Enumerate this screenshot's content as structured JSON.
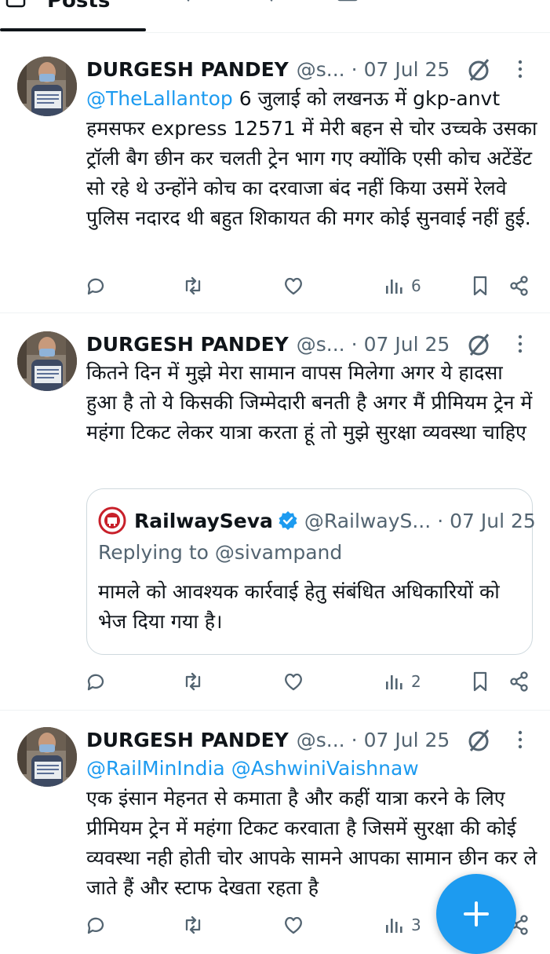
{
  "header": {
    "active_tab_label": "Posts"
  },
  "tweets": [
    {
      "author_name": "DURGESH PANDEY",
      "handle": "@s...",
      "separator": "·",
      "date": "07 Jul 25",
      "mention": "@TheLallantop",
      "text": " 6 जुलाई को लखनऊ में gkp-anvt हमसफर express 12571 में मेरी बहन से चोर उच्चके उसका ट्रॉली बैग छीन कर चलती ट्रेन भाग गए क्योंकि एसी कोच अटेंडेंट सो रहे थे उन्होंने कोच का दरवाजा बंद नहीं किया उसमें रेलवे पुलिस नदारद थी बहुत शिकायत की मगर कोई सुनवाई नहीं हुई.",
      "views": "6"
    },
    {
      "author_name": "DURGESH PANDEY",
      "handle": "@s...",
      "separator": "·",
      "date": "07 Jul 25",
      "text": "कितने दिन में मुझे मेरा सामान वापस मिलेगा अगर ये हादसा हुआ है तो ये किसकी जिम्मेदारी बनती है अगर मैं प्रीमियम ट्रेन में महंगा टिकट लेकर यात्रा करता हूं तो मुझे सुरक्षा व्यवस्था चाहिए",
      "quote": {
        "author_name": "RailwaySeva",
        "handle": "@RailwayS...",
        "separator": "·",
        "date": "07 Jul 25",
        "replying_to": "Replying to @sivampand",
        "text": "मामले को आवश्यक कार्रवाई हेतु संबंधित अधिकारियों को भेज दिया गया है।"
      },
      "views": "2"
    },
    {
      "author_name": "DURGESH PANDEY",
      "handle": "@s...",
      "separator": "·",
      "date": "07 Jul 25",
      "mention": "@RailMinIndia @AshwiniVaishnaw",
      "text": "एक इंसान मेहनत से कमाता है और कहीं यात्रा करने के लिए प्रीमियम ट्रेन में महंगा टिकट करवाता है जिसमें सुरक्षा की कोई व्यवस्था नही होती चोर आपके सामने आपका सामान छीन कर ले जाते हैं और स्टाफ देखता रहता है",
      "views": "3"
    }
  ],
  "colors": {
    "accent": "#1d9bf0",
    "text": "#0f1419",
    "muted": "#536471",
    "divider": "#eff3f4",
    "quote_border": "#cfd9de"
  },
  "icons": [
    "reply-icon",
    "repost-icon",
    "like-icon",
    "views-icon",
    "bookmark-icon",
    "share-icon",
    "grok-icon",
    "more-icon",
    "verified-icon",
    "compose-plus-icon"
  ]
}
